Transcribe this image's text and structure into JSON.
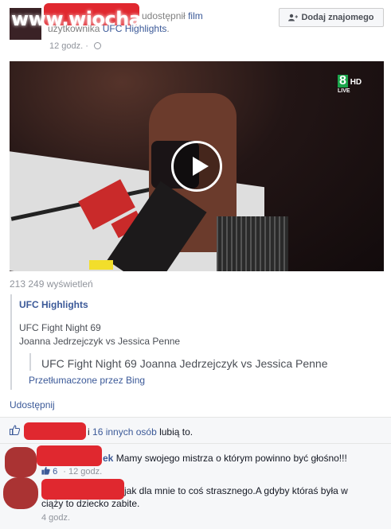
{
  "header": {
    "watermark": "www.wiocha.pl",
    "action_text": "udostępnił",
    "action_link": "film",
    "subject_prefix": "użytkownika",
    "page_name": "UFC Highlights",
    "subject_suffix": ".",
    "time": "12 godz.",
    "separator": "·",
    "add_friend_label": "Dodaj znajomego"
  },
  "video": {
    "channel_number": "8",
    "channel_badge": "HD",
    "channel_live": "LIVE",
    "views": "213 249 wyświetleń"
  },
  "shared": {
    "title": "UFC Highlights",
    "line1": "UFC Fight Night 69",
    "line2": "Joanna Jedrzejczyk vs Jessica Penne",
    "translation": "UFC Fight Night 69 Joanna Jedrzejczyk vs Jessica Penne",
    "translated_by": "Przetłumaczone przez Bing"
  },
  "actions": {
    "share": "Udostępnij"
  },
  "likes": {
    "prefix": "i",
    "others_link": "16 innych osób",
    "suffix": "lubią to."
  },
  "comments": [
    {
      "name_tail": "ek",
      "text": "Mamy swojego mistrza o którym powinno być głośno!!!",
      "like_count": "6",
      "time": "12 godz."
    },
    {
      "text": "jak dla mnie to coś strasznego.A gdyby któraś była w ciąży to dziecko zabite.",
      "time": "4 godz."
    }
  ],
  "colors": {
    "link": "#3b5998",
    "redaction": "#e0282f",
    "hd_green": "#1aa54b"
  }
}
